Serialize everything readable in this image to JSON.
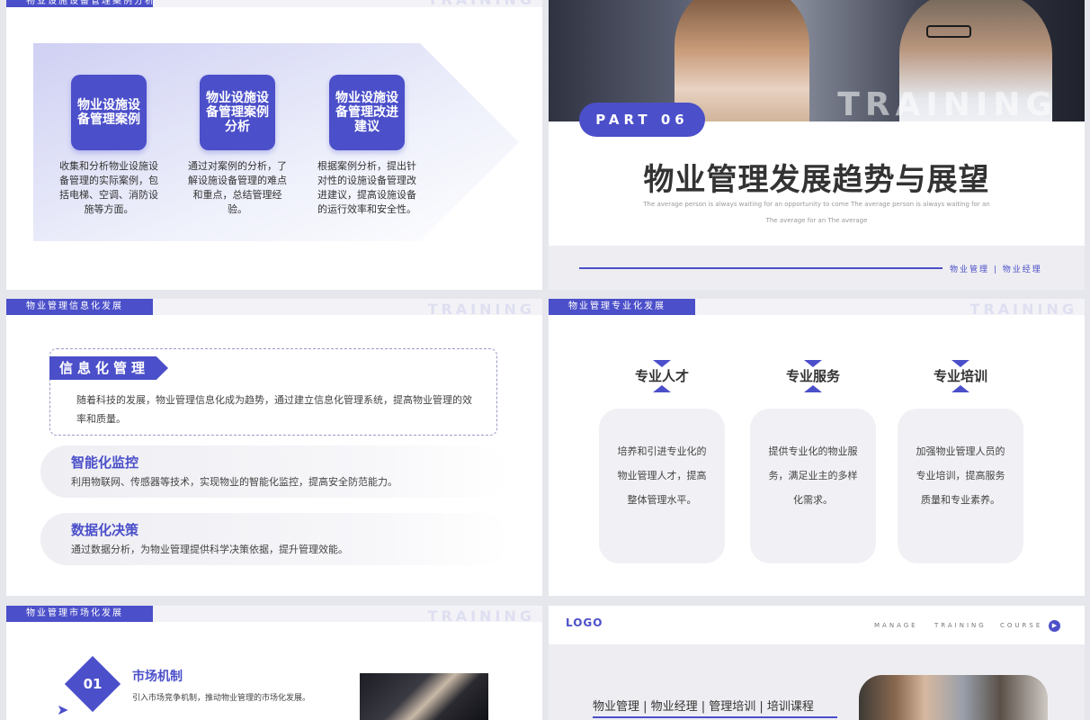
{
  "slide1": {
    "header_tag": "物业设施设备管理案例分析",
    "watermark": "TRAINING",
    "items": [
      {
        "title": "物业设施设备管理案例",
        "text": "收集和分析物业设施设备管理的实际案例，包括电梯、空调、消防设施等方面。"
      },
      {
        "title": "物业设施设备管理案例分析",
        "text": "通过对案例的分析，了解设施设备管理的难点和重点，总结管理经验。"
      },
      {
        "title": "物业设施设备管理改进建议",
        "text": "根据案例分析，提出针对性的设施设备管理改进建议，提高设施设备的运行效率和安全性。"
      }
    ]
  },
  "slide2": {
    "part_label": "PART 06",
    "photo_watermark": "TRAINING",
    "title": "物业管理发展趋势与展望",
    "subtitle1": "The average person is always waiting for an opportunity to come The average person is always waiting for an",
    "subtitle2": "The average for an The average",
    "footer_links": "物业管理 | 物业经理"
  },
  "slide3": {
    "header_tag": "物业管理信息化发展",
    "watermark": "TRAINING",
    "card_tag": "信息化管理",
    "card_text": "随着科技的发展，物业管理信息化成为趋势，通过建立信息化管理系统，提高物业管理的效率和质量。",
    "rows": [
      {
        "title": "智能化监控",
        "text": "利用物联网、传感器等技术，实现物业的智能化监控，提高安全防范能力。"
      },
      {
        "title": "数据化决策",
        "text": "通过数据分析，为物业管理提供科学决策依据，提升管理效能。"
      }
    ]
  },
  "slide4": {
    "header_tag": "物业管理专业化发展",
    "watermark": "TRAINING",
    "columns": [
      {
        "title": "专业人才",
        "text": "培养和引进专业化的物业管理人才，提高整体管理水平。"
      },
      {
        "title": "专业服务",
        "text": "提供专业化的物业服务，满足业主的多样化需求。"
      },
      {
        "title": "专业培训",
        "text": "加强物业管理人员的专业培训，提高服务质量和专业素养。"
      }
    ]
  },
  "slide5": {
    "header_tag": "物业管理市场化发展",
    "watermark": "TRAINING",
    "number": "01",
    "title": "市场机制",
    "text": "引入市场竞争机制，推动物业管理的市场化发展。"
  },
  "slide6": {
    "logo": "LOGO",
    "nav": [
      "MANAGE",
      "TRAINING",
      "COURSE"
    ],
    "links": "物业管理 | 物业经理 | 管理培训 | 培训课程"
  },
  "colors": {
    "accent": "#4b4fc9",
    "background": "#e6e7ec"
  }
}
